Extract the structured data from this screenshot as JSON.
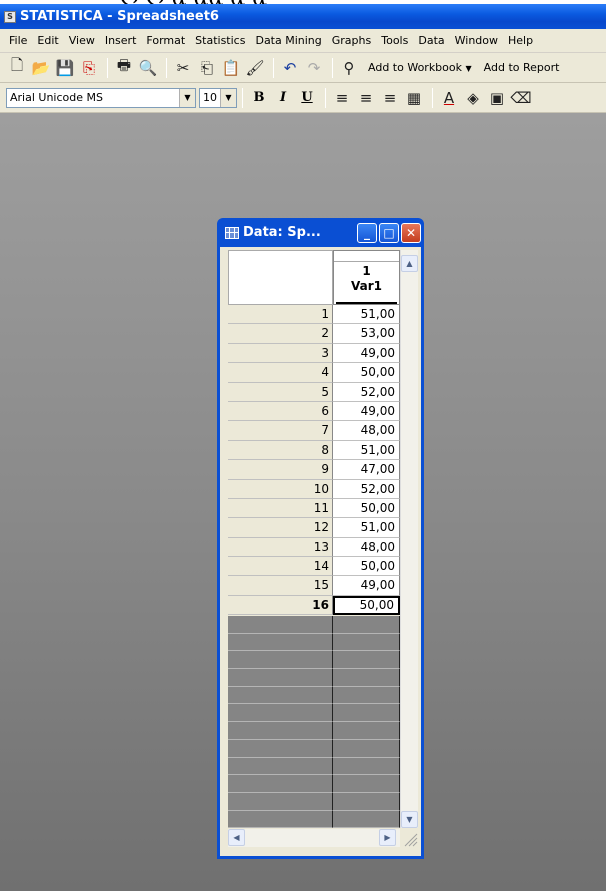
{
  "app": {
    "title": "STATISTICA - Spreadsheet6",
    "top_cropped_text": "ღ  ღ  ᾶ   ᾶᾶ ᾶ ᾶ"
  },
  "menu": [
    "File",
    "Edit",
    "View",
    "Insert",
    "Format",
    "Statistics",
    "Data Mining",
    "Graphs",
    "Tools",
    "Data",
    "Window",
    "Help"
  ],
  "toolbar": {
    "add_to_workbook": "Add to Workbook",
    "add_to_report": "Add to Report",
    "font_name": "Arial Unicode MS",
    "font_size": "10",
    "bold": "B",
    "italic": "I",
    "underline": "U"
  },
  "sheet_window": {
    "title": "Data: Sp...",
    "column": {
      "number": "1",
      "name": "Var1"
    },
    "row_numbers": [
      "1",
      "2",
      "3",
      "4",
      "5",
      "6",
      "7",
      "8",
      "9",
      "10",
      "11",
      "12",
      "13",
      "14",
      "15",
      "16"
    ],
    "values": [
      "51,00",
      "53,00",
      "49,00",
      "50,00",
      "52,00",
      "49,00",
      "48,00",
      "51,00",
      "47,00",
      "52,00",
      "50,00",
      "51,00",
      "48,00",
      "50,00",
      "49,00",
      "50,00"
    ],
    "active_row": 16
  }
}
